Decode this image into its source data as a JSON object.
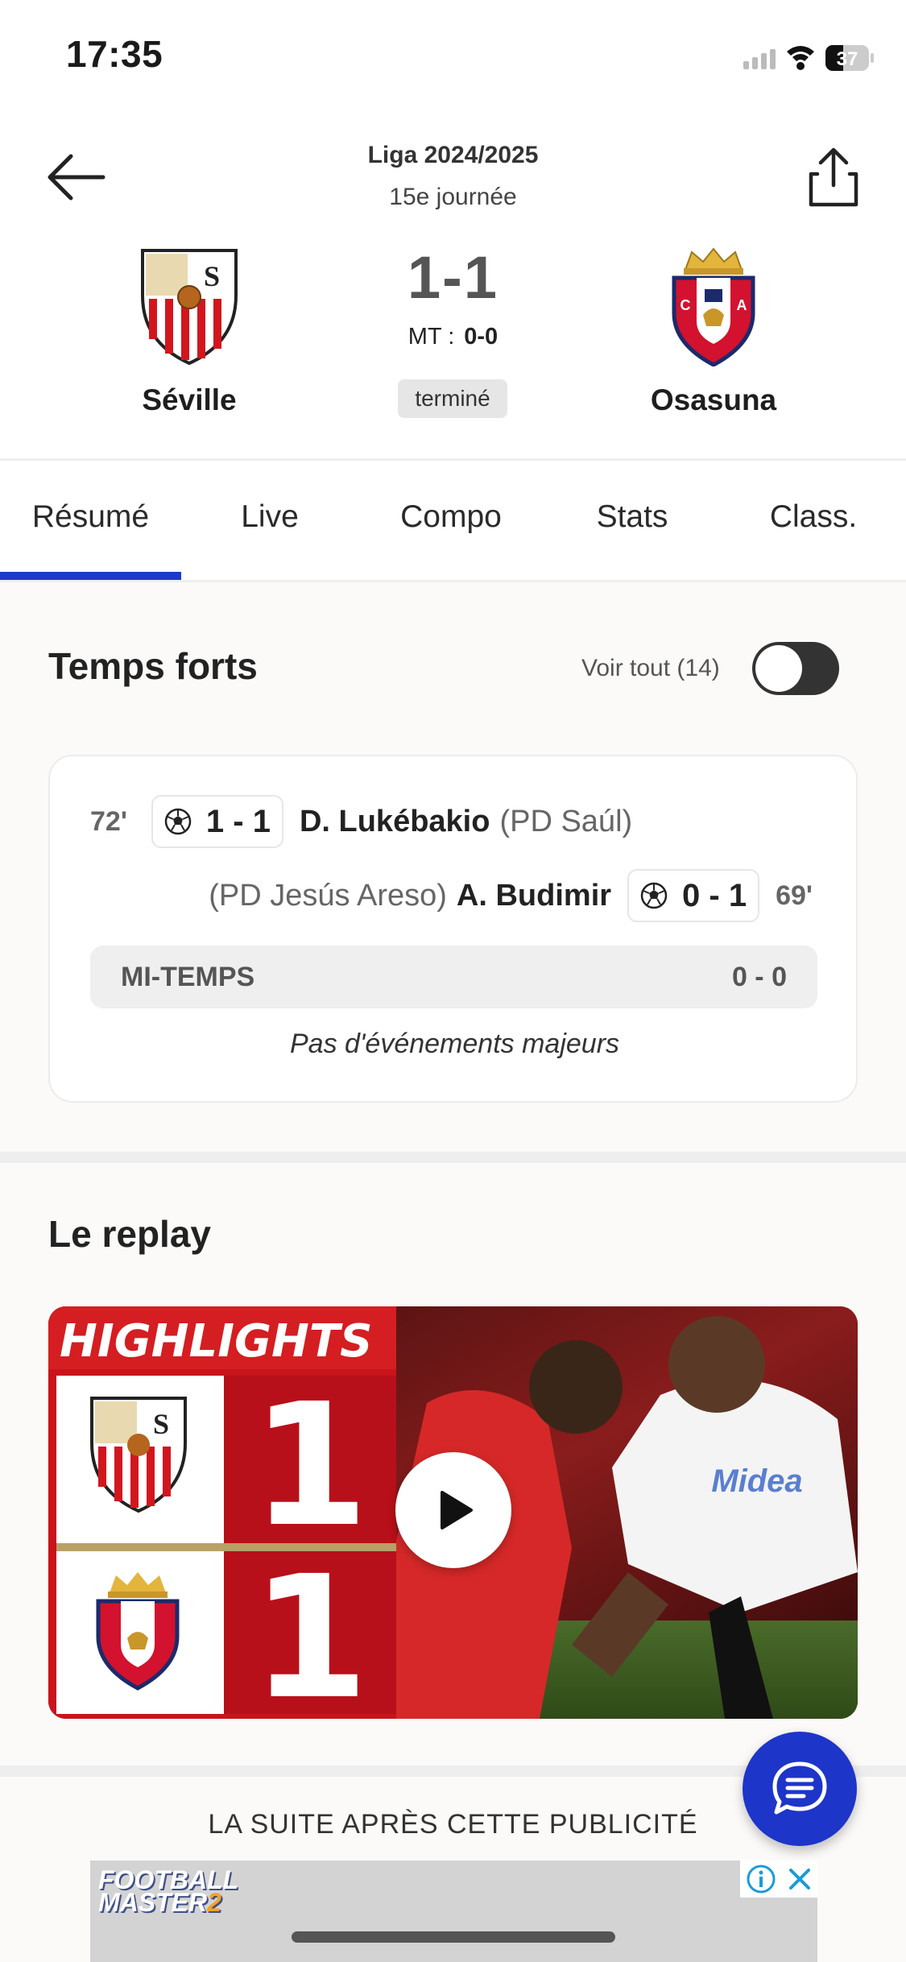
{
  "status_bar": {
    "time": "17:35",
    "battery": "37"
  },
  "header": {
    "league": "Liga 2024/2025",
    "round": "15e journée"
  },
  "match": {
    "home_team": "Séville",
    "away_team": "Osasuna",
    "score": "1-1",
    "halftime_label": "MT :",
    "halftime_score": "0-0",
    "status": "terminé"
  },
  "tabs": [
    {
      "label": "Résumé",
      "active": true
    },
    {
      "label": "Live",
      "active": false
    },
    {
      "label": "Compo",
      "active": false
    },
    {
      "label": "Stats",
      "active": false
    },
    {
      "label": "Class.",
      "active": false
    }
  ],
  "highlights": {
    "title": "Temps forts",
    "see_all": "Voir tout (14)",
    "toggle_on": false,
    "events": [
      {
        "minute": "72'",
        "score": "1 - 1",
        "player": "D. Lukébakio",
        "assist": "(PD Saúl)",
        "side": "home"
      },
      {
        "minute": "69'",
        "score": "0 - 1",
        "player": "A. Budimir",
        "assist": "(PD Jesús Areso)",
        "side": "away"
      }
    ],
    "halftime_label": "MI-TEMPS",
    "halftime_score": "0 - 0",
    "no_events": "Pas d'événements majeurs"
  },
  "replay": {
    "title": "Le replay",
    "thumbnail_banner": "HIGHLIGHTS",
    "home_goals": "1",
    "away_goals": "1",
    "jersey_sponsor": "Midea"
  },
  "ad": {
    "label": "LA SUITE APRÈS CETTE PUBLICITÉ",
    "brand_line1": "FOOTBALL",
    "brand_line2": "MASTER",
    "brand_number": "2"
  },
  "colors": {
    "accent": "#1d3acd",
    "fab": "#1d35c9",
    "sevilla_red": "#d2161e",
    "osasuna_red": "#d2122e",
    "osasuna_navy": "#1b2a6b"
  },
  "icons": [
    "back-arrow-icon",
    "share-icon",
    "soccer-ball-icon",
    "play-icon",
    "chat-icon",
    "info-icon",
    "close-icon",
    "wifi-icon",
    "signal-icon",
    "battery-icon"
  ]
}
